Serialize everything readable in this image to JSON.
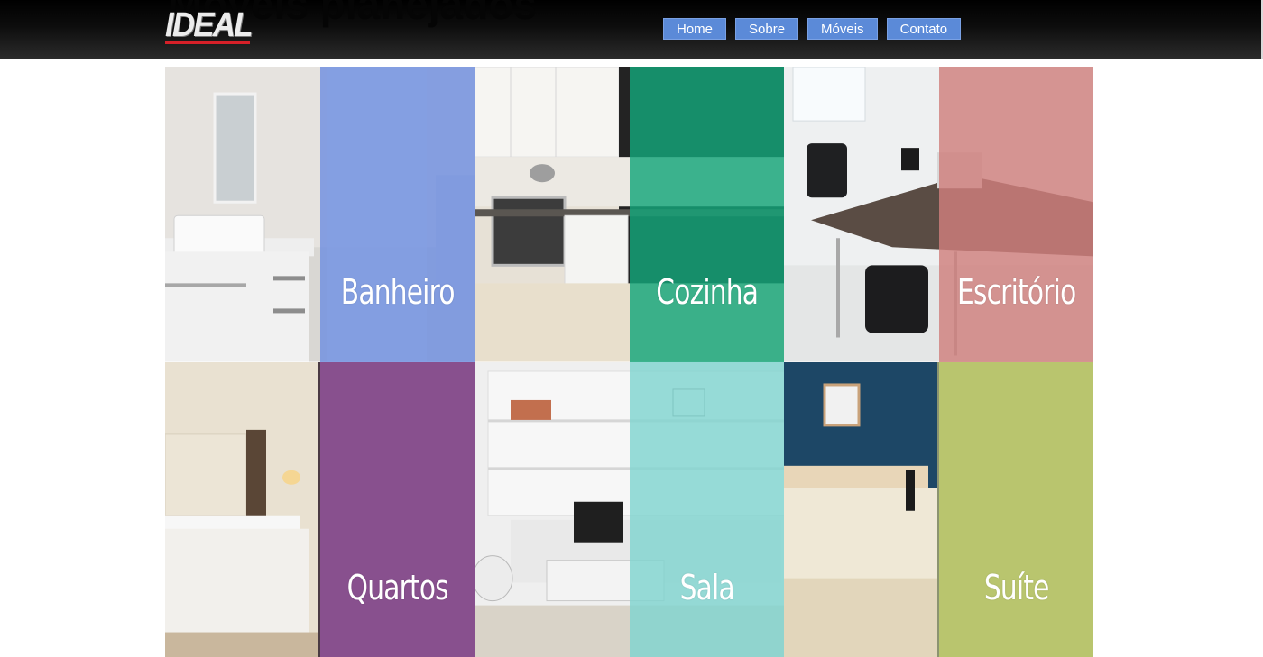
{
  "header": {
    "background_heading": "Móveis planejados",
    "logo_text": "IDEAL",
    "nav": [
      {
        "label": "Home"
      },
      {
        "label": "Sobre"
      },
      {
        "label": "Móveis"
      },
      {
        "label": "Contato"
      }
    ]
  },
  "tiles": [
    {
      "label": "Banheiro",
      "overlay_color": "#6f8fe0"
    },
    {
      "label": "Cozinha",
      "overlay_color": "#14a67a"
    },
    {
      "label": "Escritório",
      "overlay_color": "#cf7f7c"
    },
    {
      "label": "Quartos",
      "overlay_color": "#96559f"
    },
    {
      "label": "Sala",
      "overlay_color": "#80d4d0"
    },
    {
      "label": "Suíte",
      "overlay_color": "#c3cf6e"
    }
  ]
}
